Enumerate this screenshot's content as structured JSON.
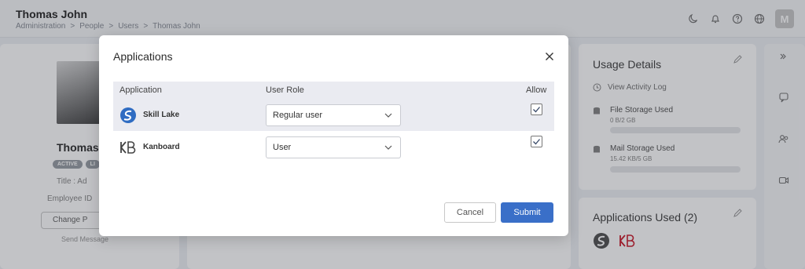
{
  "header": {
    "title": "Thomas John",
    "breadcrumb": [
      "Administration",
      "People",
      "Users",
      "Thomas John"
    ],
    "breadcrumb_separator": ">",
    "avatar_initial": "M"
  },
  "profile": {
    "name": "Thomas",
    "badges": [
      "ACTIVE",
      "LI"
    ],
    "title_label": "Title : Ad",
    "employee_label": "Employee ID",
    "change_button": "Change P",
    "send_message": "Send Message"
  },
  "usage": {
    "title": "Usage Details",
    "view_log": "View Activity Log",
    "file_storage_label": "File Storage Used",
    "file_storage_value": "0 B/2 GB",
    "mail_storage_label": "Mail Storage Used",
    "mail_storage_value": "15.42 KB/5 GB"
  },
  "apps_used": {
    "title": "Applications Used (2)"
  },
  "modal": {
    "title": "Applications",
    "columns": {
      "application": "Application",
      "role": "User Role",
      "allow": "Allow"
    },
    "rows": [
      {
        "app": "Skill Lake",
        "role": "Regular user",
        "allowed": true
      },
      {
        "app": "Kanboard",
        "role": "User",
        "allowed": true
      }
    ],
    "cancel_label": "Cancel",
    "submit_label": "Submit"
  },
  "colors": {
    "accent": "#3a6fc8",
    "overlay": "#14182442",
    "kanboard_logo": "#444444",
    "skill_lake_logo": "#2f6cc2"
  }
}
